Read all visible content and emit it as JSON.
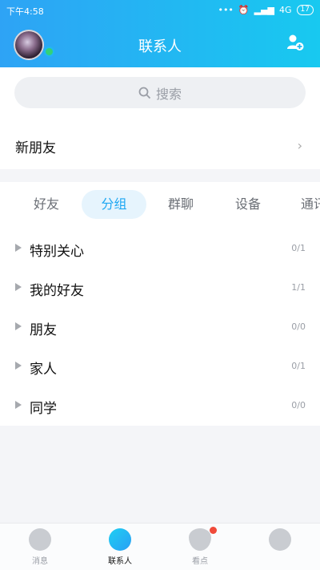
{
  "status": {
    "time": "下午4:58",
    "signal": "4G",
    "battery": "17"
  },
  "header": {
    "title": "联系人"
  },
  "search": {
    "placeholder": "搜索"
  },
  "new_friends": {
    "label": "新朋友"
  },
  "tabs": [
    {
      "label": "好友"
    },
    {
      "label": "分组"
    },
    {
      "label": "群聊"
    },
    {
      "label": "设备"
    },
    {
      "label": "通讯录"
    }
  ],
  "groups": [
    {
      "name": "特别关心",
      "count": "0/1"
    },
    {
      "name": "我的好友",
      "count": "1/1"
    },
    {
      "name": "朋友",
      "count": "0/0"
    },
    {
      "name": "家人",
      "count": "0/1"
    },
    {
      "name": "同学",
      "count": "0/0"
    }
  ],
  "nav": [
    {
      "label": "消息"
    },
    {
      "label": "联系人"
    },
    {
      "label": "看点"
    },
    {
      "label": ""
    }
  ],
  "colors": {
    "accent": "#1ea7f2",
    "header_start": "#2ea3f5",
    "header_end": "#18c9f0"
  }
}
